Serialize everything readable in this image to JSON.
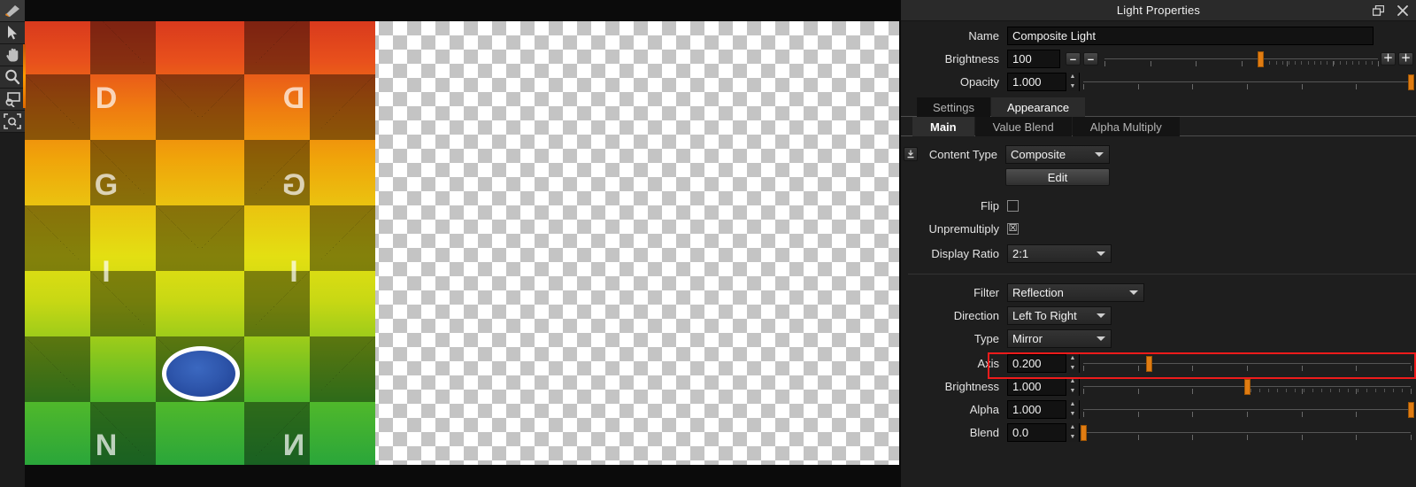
{
  "toolbar": {
    "tools": [
      {
        "name": "brush-tool",
        "label": "Brush"
      },
      {
        "name": "select-tool",
        "label": "Select"
      },
      {
        "name": "pan-tool",
        "label": "Pan"
      },
      {
        "name": "zoom-tool",
        "label": "Zoom"
      },
      {
        "name": "zoom-region-tool",
        "label": "Zoom Region"
      },
      {
        "name": "zoom-fit-tool",
        "label": "Zoom Fit"
      }
    ]
  },
  "canvas": {
    "letters": [
      "D",
      "G",
      "I",
      "N"
    ],
    "mirror_axis": 0.2,
    "shape": "ellipse"
  },
  "panel": {
    "title": "Light Properties",
    "undock_glyph": "❐",
    "close_glyph": "✕",
    "name": {
      "label": "Name",
      "value": "Composite Light"
    },
    "brightness": {
      "label": "Brightness",
      "value": "100",
      "minus_glyph": "–",
      "plus_glyph": "＋",
      "handle_pct": 57
    },
    "opacity": {
      "label": "Opacity",
      "value": "1.000",
      "handle_pct": 100
    },
    "outer_tabs": [
      {
        "label": "Settings",
        "active": false
      },
      {
        "label": "Appearance",
        "active": true
      }
    ],
    "inner_tabs": [
      {
        "label": "Main",
        "active": true
      },
      {
        "label": "Value Blend",
        "active": false
      },
      {
        "label": "Alpha Multiply",
        "active": false
      }
    ],
    "content_type": {
      "label": "Content Type",
      "value": "Composite"
    },
    "edit_button": "Edit",
    "flip": {
      "label": "Flip",
      "checked": false,
      "mark": ""
    },
    "unpremultiply": {
      "label": "Unpremultiply",
      "checked": true,
      "mark": "☒"
    },
    "display_ratio": {
      "label": "Display Ratio",
      "value": "2:1"
    },
    "filter": {
      "label": "Filter",
      "value": "Reflection"
    },
    "direction": {
      "label": "Direction",
      "value": "Left To Right"
    },
    "type": {
      "label": "Type",
      "value": "Mirror"
    },
    "axis": {
      "label": "Axis",
      "value": "0.200",
      "handle_pct": 20,
      "highlighted": true
    },
    "fx_brightness": {
      "label": "Brightness",
      "value": "1.000",
      "handle_pct": 50
    },
    "alpha": {
      "label": "Alpha",
      "value": "1.000",
      "handle_pct": 100
    },
    "blend": {
      "label": "Blend",
      "value": "0.0",
      "handle_pct": 0
    }
  },
  "colors": {
    "accent_orange": "#e07c12",
    "highlight_red": "#ef1b1b",
    "panel_bg": "#1e1e1e",
    "field_bg": "#121212"
  }
}
